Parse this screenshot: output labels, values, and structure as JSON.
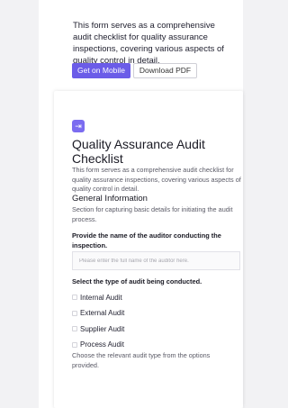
{
  "intro": {
    "description": "This form serves as a comprehensive audit checklist for quality assurance inspections, covering various aspects of quality control in detail.",
    "get_mobile_label": "Get on Mobile",
    "download_pdf_label": "Download PDF"
  },
  "form": {
    "icon": "sign-in-arrow-icon",
    "accent_color": "#6b5ce8",
    "title": "Quality Assurance Audit Checklist",
    "description": "This form serves as a comprehensive audit checklist for quality assurance inspections, covering various aspects of quality control in detail.",
    "section": {
      "title": "General Information",
      "description": "Section for capturing basic details for initiating the audit process."
    },
    "auditor_question": {
      "label": "Provide the name of the auditor conducting the inspection.",
      "placeholder": "Please enter the full name of the auditor here."
    },
    "audit_type_question": {
      "label": "Select the type of audit being conducted.",
      "options": [
        "Internal Audit",
        "External Audit",
        "Supplier Audit",
        "Process Audit"
      ],
      "help": "Choose the relevant audit type from the options provided."
    }
  }
}
